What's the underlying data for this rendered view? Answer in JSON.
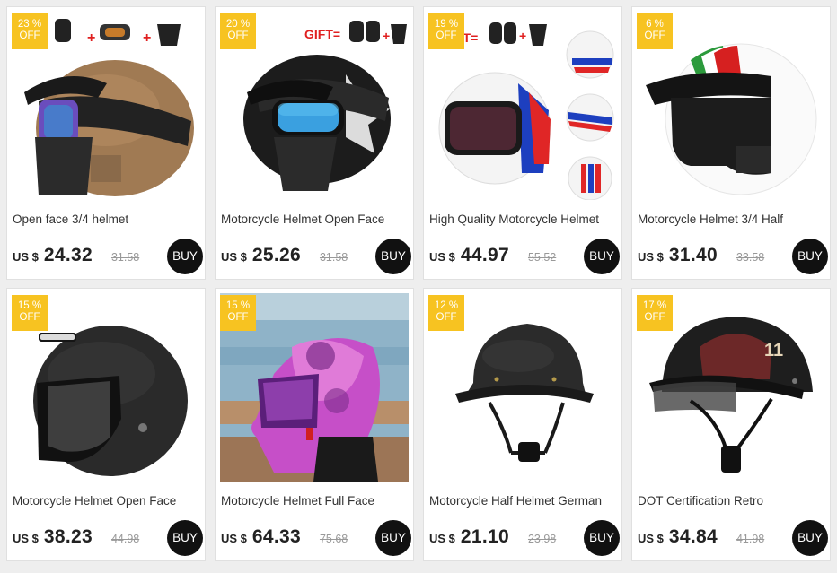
{
  "currency_label": "US $",
  "buy_label": "BUY",
  "off_label": "OFF",
  "gift_label": "GIFT=",
  "colors": {
    "badge": "#f7c321",
    "buy_button": "#111111",
    "card_bg": "#ffffff",
    "page_bg": "#eeeeee"
  },
  "products": [
    {
      "discount": "23 %",
      "title": "Open face 3/4 helmet",
      "price": "24.32",
      "old_price": "31.58",
      "image_icon": "brown-leather-helmet-with-goggles-icon"
    },
    {
      "discount": "20 %",
      "title": "Motorcycle Helmet Open Face",
      "price": "25.26",
      "old_price": "31.58",
      "image_icon": "black-star-helmet-with-goggles-icon"
    },
    {
      "discount": "19 %",
      "title": "High Quality Motorcycle Helmet",
      "price": "44.97",
      "old_price": "55.52",
      "image_icon": "white-stripe-helmet-icon"
    },
    {
      "discount": "6 %",
      "title": "Motorcycle Helmet 3/4 Half",
      "price": "31.40",
      "old_price": "33.58",
      "image_icon": "white-italian-stripe-helmet-icon"
    },
    {
      "discount": "15 %",
      "title": "Motorcycle Helmet Open Face",
      "price": "38.23",
      "old_price": "44.98",
      "image_icon": "matte-black-open-face-helmet-icon"
    },
    {
      "discount": "15 %",
      "title": "Motorcycle Helmet Full Face",
      "price": "64.33",
      "old_price": "75.68",
      "image_icon": "pink-rose-full-face-helmet-icon"
    },
    {
      "discount": "12 %",
      "title": "Motorcycle Half Helmet German",
      "price": "21.10",
      "old_price": "23.98",
      "image_icon": "german-half-helmet-icon"
    },
    {
      "discount": "17 %",
      "title": "DOT Certification Retro",
      "price": "34.84",
      "old_price": "41.98",
      "image_icon": "lucky-eleven-half-helmet-icon"
    }
  ]
}
